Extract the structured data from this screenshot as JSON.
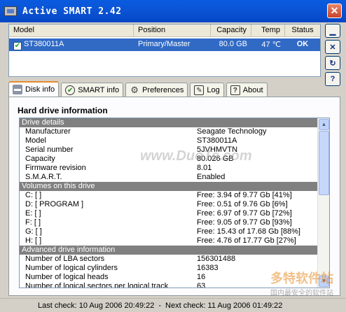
{
  "window": {
    "title": "Active SMART 2.42"
  },
  "drive_list": {
    "columns": [
      "Model",
      "Position",
      "Capacity",
      "Temp",
      "Status"
    ],
    "rows": [
      {
        "model": "ST380011A",
        "position": "Primary/Master",
        "capacity": "80.0 GB",
        "temp": "47 ℃",
        "status": "OK"
      }
    ]
  },
  "side_buttons": [
    "minimize-icon",
    "close-icon",
    "refresh-icon",
    "help-icon"
  ],
  "tabs": [
    {
      "label": "Disk info",
      "icon": "disk-icon",
      "active": true
    },
    {
      "label": "SMART info",
      "icon": "check-icon",
      "active": false
    },
    {
      "label": "Preferences",
      "icon": "gear-icon",
      "active": false
    },
    {
      "label": "Log",
      "icon": "log-icon",
      "active": false
    },
    {
      "label": "About",
      "icon": "help-icon",
      "active": false
    }
  ],
  "panel": {
    "title": "Hard drive information",
    "sections": [
      {
        "title": "Drive details",
        "rows": [
          [
            "Manufacturer",
            "Seagate Technology"
          ],
          [
            "Model",
            "ST380011A"
          ],
          [
            "Serial number",
            "5JVHMVTN"
          ],
          [
            "Capacity",
            "80.026 GB"
          ],
          [
            "Firmware revision",
            "8.01"
          ],
          [
            "S.M.A.R.T.",
            "Enabled"
          ]
        ]
      },
      {
        "title": "Volumes on this drive",
        "rows": [
          [
            "C: [ ]",
            "Free: 3.94 of 9.77 Gb [41%]"
          ],
          [
            "D: [ PROGRAM ]",
            "Free: 0.51 of 9.76 Gb [6%]"
          ],
          [
            "E: [ ]",
            "Free: 6.97 of 9.77 Gb [72%]"
          ],
          [
            "F: [ ]",
            "Free: 9.05 of 9.77 Gb [93%]"
          ],
          [
            "G: [ ]",
            "Free: 15.43 of 17.68 Gb [88%]"
          ],
          [
            "H: [ ]",
            "Free: 4.76 of 17.77 Gb [27%]"
          ]
        ]
      },
      {
        "title": "Advanced drive information",
        "rows": [
          [
            "Number of LBA sectors",
            "156301488"
          ],
          [
            "Number of logical cylinders",
            "16383"
          ],
          [
            "Number of logical heads",
            "16"
          ],
          [
            "Number of logical sectors per logical track",
            "63"
          ]
        ]
      }
    ]
  },
  "status_bar": {
    "last_check": "Last check: 10 Aug 2006  20:49:22",
    "separator": "-",
    "next_check": "Next check: 11 Aug 2006  01:49:22"
  },
  "watermark": {
    "text": "www.DuoTe.com",
    "logo_big": "多特软件站",
    "logo_small": "国内最安全的软件站"
  }
}
